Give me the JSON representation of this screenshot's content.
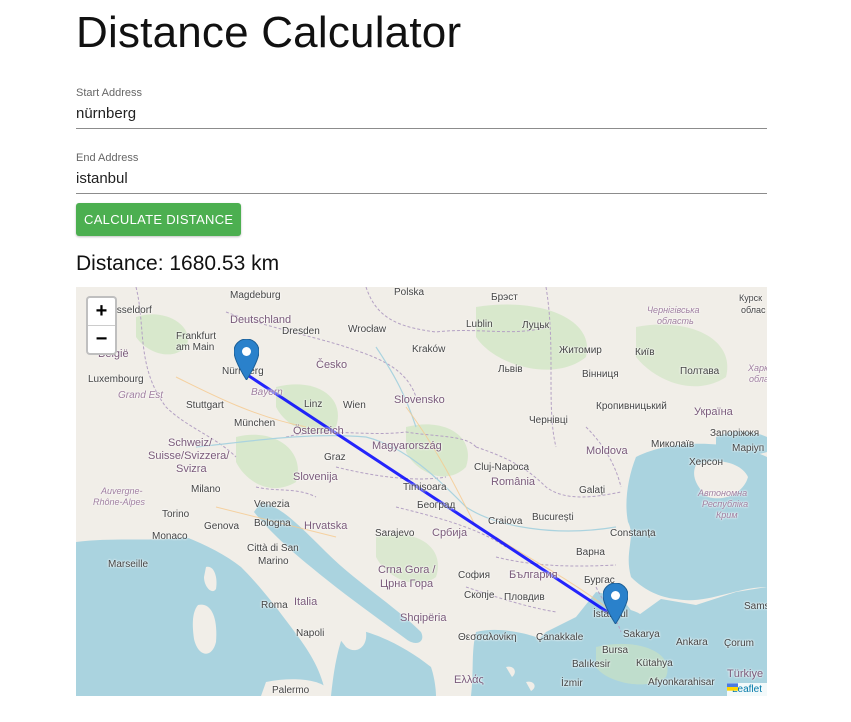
{
  "page": {
    "title": "Distance Calculator"
  },
  "form": {
    "start_label": "Start Address",
    "start_value": "nürnberg",
    "end_label": "End Address",
    "end_value": "istanbul",
    "button_label": "CALCULATE DISTANCE"
  },
  "result": {
    "distance_text": "Distance: 1680.53 km"
  },
  "map": {
    "zoom_in": "+",
    "zoom_out": "−",
    "attribution": "Leaflet",
    "route_color": "#0000ff",
    "marker_color": "#2a81cb",
    "labels": {
      "polska": "Polska",
      "magdeburg": "Magdeburg",
      "dusseldorf": "Düsseldorf",
      "deutschland": "Deutschland",
      "dresden": "Dresden",
      "wroclaw": "Wrocław",
      "frankfurt": "Frankfurt",
      "am_main": "am Main",
      "belgie": "België",
      "luxembourg": "Luxembourg",
      "nurnberg": "Nürnberg",
      "cesko": "Česko",
      "krakow": "Kraków",
      "lublin": "Lublin",
      "brest": "Брэст",
      "lutsk": "Луцьк",
      "zhytomyr": "Житомир",
      "kyiv": "Київ",
      "lviv": "Львів",
      "vinnytsia": "Вінниця",
      "poltava": "Полтава",
      "grand_est": "Grand Est",
      "stuttgart": "Stuttgart",
      "bayern": "Bayern",
      "linz": "Linz",
      "wien": "Wien",
      "slovensko": "Slovensko",
      "chernivtsi": "Чернівці",
      "kropyvnytskyi": "Кропивницький",
      "ukraina": "Україна",
      "munchen": "München",
      "osterreich": "Österreich",
      "magyarorszag": "Magyarország",
      "mykolaiv": "Миколаїв",
      "zaporizhzhia": "Запоріжжя",
      "schweiz": "Schweiz/",
      "suisse": "Suisse/Svizzera/",
      "svizra": "Svizra",
      "graz": "Graz",
      "cluj": "Cluj-Napoca",
      "moldova": "Moldova",
      "kherson": "Херсон",
      "mariupol": "Маріуп",
      "slovenija": "Slovenija",
      "romania": "România",
      "milano": "Milano",
      "auvergne": "Auvergne-",
      "rhone_alpes": "Rhône-Alpes",
      "timisoara": "Timișoara",
      "galati": "Galați",
      "avtonomna": "Автономна",
      "respublika": "Республіка",
      "krym": "Крим",
      "torino": "Torino",
      "genova": "Genova",
      "venezia": "Venezia",
      "hrvatska": "Hrvatska",
      "beograd": "Београд",
      "craiova": "Craiova",
      "bucuresti": "București",
      "monaco": "Monaco",
      "bologna": "Bologna",
      "sarajevo": "Sarajevo",
      "srbija": "Србија",
      "constanta": "Constanța",
      "citta": "Città di San",
      "marino": "Marino",
      "varna": "Варна",
      "marseille": "Marseille",
      "crna_gora": "Crna Gora /",
      "crna_gora_cyr": "Црна Гора",
      "sofia": "София",
      "bulgaria": "България",
      "burgas": "Бургас",
      "italia": "Italia",
      "skopje": "Скопје",
      "plovdiv": "Пловдив",
      "roma": "Roma",
      "shqiperia": "Shqipëria",
      "istanbul": "İstanbul",
      "sakarya": "Sakarya",
      "napoli": "Napoli",
      "thessaloniki": "Θεσσαλονίκη",
      "canakkale": "Çanakkale",
      "bursa": "Bursa",
      "ankara": "Ankara",
      "corum": "Çorum",
      "balikesir": "Balıkesir",
      "kutahya": "Kütahya",
      "turkiye": "Türkiye",
      "ellas": "Ελλάς",
      "izmir": "İzmir",
      "afyonkarahisar": "Afyonkarahisar",
      "palermo": "Palermo",
      "kursk": "Курск",
      "oblast": "облас",
      "chernihiv": "Чернігівська",
      "chernihiv2": "область",
      "kharkiv": "Харк",
      "kharkiv2": "обла",
      "sams": "Sams"
    }
  }
}
